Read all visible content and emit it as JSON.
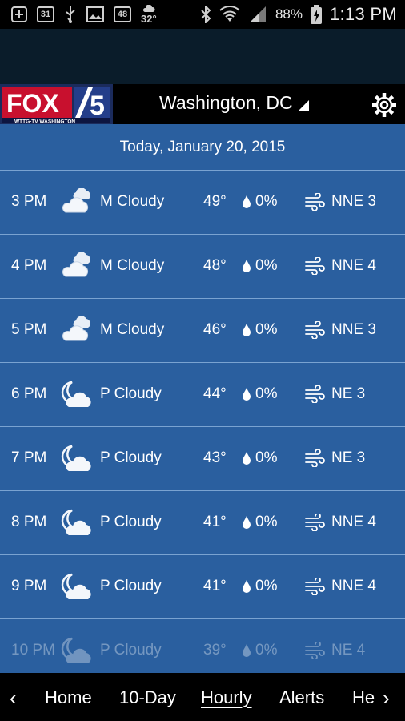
{
  "status_bar": {
    "calendar_day": "31",
    "temp_icon_value": "48",
    "small_temp": "32°",
    "battery": "88%",
    "time": "1:13 PM"
  },
  "header": {
    "logo_text": "FOX 5",
    "logo_sub": "WTTG-TV WASHINGTON",
    "location": "Washington, DC"
  },
  "date": "Today, January 20, 2015",
  "hours": [
    {
      "time": "3 PM",
      "icon": "mostly-cloudy-icon",
      "condition": "M Cloudy",
      "temp": "49°",
      "precip": "0%",
      "wind": "NNE 3"
    },
    {
      "time": "4 PM",
      "icon": "mostly-cloudy-icon",
      "condition": "M Cloudy",
      "temp": "48°",
      "precip": "0%",
      "wind": "NNE 4"
    },
    {
      "time": "5 PM",
      "icon": "mostly-cloudy-icon",
      "condition": "M Cloudy",
      "temp": "46°",
      "precip": "0%",
      "wind": "NNE 3"
    },
    {
      "time": "6 PM",
      "icon": "partly-cloudy-night-icon",
      "condition": "P Cloudy",
      "temp": "44°",
      "precip": "0%",
      "wind": "NE 3"
    },
    {
      "time": "7 PM",
      "icon": "partly-cloudy-night-icon",
      "condition": "P Cloudy",
      "temp": "43°",
      "precip": "0%",
      "wind": "NE 3"
    },
    {
      "time": "8 PM",
      "icon": "partly-cloudy-night-icon",
      "condition": "P Cloudy",
      "temp": "41°",
      "precip": "0%",
      "wind": "NNE 4"
    },
    {
      "time": "9 PM",
      "icon": "partly-cloudy-night-icon",
      "condition": "P Cloudy",
      "temp": "41°",
      "precip": "0%",
      "wind": "NNE 4"
    },
    {
      "time": "10 PM",
      "icon": "partly-cloudy-night-icon",
      "condition": "P Cloudy",
      "temp": "39°",
      "precip": "0%",
      "wind": "NE 4"
    }
  ],
  "nav": {
    "prev": "‹",
    "next": "›",
    "items": [
      "Home",
      "10-Day",
      "Hourly",
      "Alerts",
      "He"
    ],
    "active": "Hourly"
  },
  "colors": {
    "accent_blue": "#2a5f9f",
    "divider": "#7aa3d1",
    "bar_black": "#000000"
  }
}
